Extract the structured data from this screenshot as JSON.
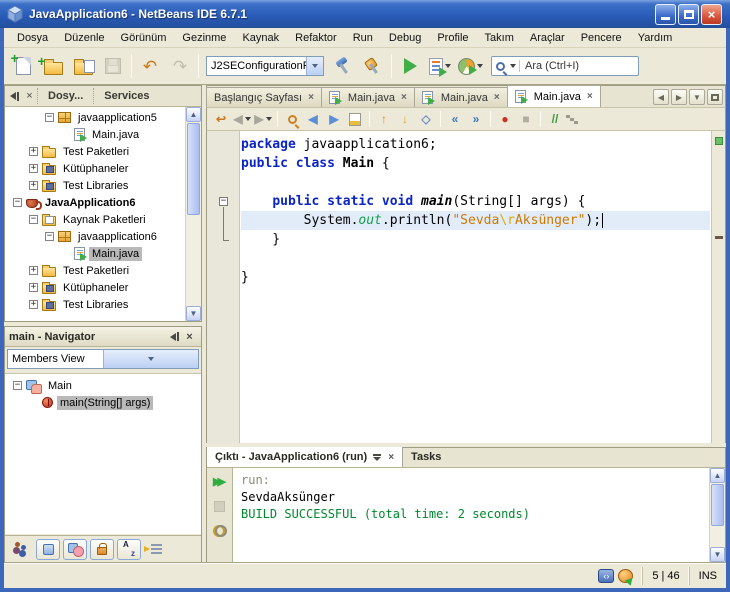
{
  "window": {
    "title": "JavaApplication6 - NetBeans IDE 6.7.1"
  },
  "menu": [
    "Dosya",
    "Düzenle",
    "Görünüm",
    "Gezinme",
    "Kaynak",
    "Refaktor",
    "Run",
    "Debug",
    "Profile",
    "Takım",
    "Araçlar",
    "Pencere",
    "Yardım"
  ],
  "toolbar": {
    "config_value": "J2SEConfigurationPr...",
    "search_placeholder": "Ara (Ctrl+I)",
    "icon_glyphs": {
      "undo": "↶",
      "redo": "↷"
    },
    "buttons": [
      "new-file",
      "new-project",
      "open-project",
      "save-all",
      "undo",
      "redo",
      "build-project",
      "clean-and-build",
      "run-project",
      "debug-project",
      "profile-project",
      "quick-search"
    ]
  },
  "projects": {
    "tabs": [
      "Dosy...",
      "Services"
    ],
    "tree": [
      {
        "indent": 2,
        "expander": "-",
        "icon": "package",
        "label": "javaapplication5"
      },
      {
        "indent": 3,
        "expander": "",
        "icon": "java",
        "label": "Main.java"
      },
      {
        "indent": 1,
        "expander": "+",
        "icon": "folder",
        "label": "Test Paketleri"
      },
      {
        "indent": 1,
        "expander": "+",
        "icon": "folder-lib",
        "label": "Kütüphaneler"
      },
      {
        "indent": 1,
        "expander": "+",
        "icon": "folder-lib",
        "label": "Test Libraries"
      },
      {
        "indent": 0,
        "expander": "-",
        "icon": "project",
        "label": "JavaApplication6",
        "bold": true
      },
      {
        "indent": 1,
        "expander": "-",
        "icon": "folder-src",
        "label": "Kaynak Paketleri"
      },
      {
        "indent": 2,
        "expander": "-",
        "icon": "package",
        "label": "javaapplication6"
      },
      {
        "indent": 3,
        "expander": "",
        "icon": "java",
        "label": "Main.java",
        "selected": true
      },
      {
        "indent": 1,
        "expander": "+",
        "icon": "folder",
        "label": "Test Paketleri"
      },
      {
        "indent": 1,
        "expander": "+",
        "icon": "folder-lib",
        "label": "Kütüphaneler"
      },
      {
        "indent": 1,
        "expander": "+",
        "icon": "folder-lib",
        "label": "Test Libraries"
      }
    ]
  },
  "navigator": {
    "title": "main - Navigator",
    "view": "Members View",
    "tree": [
      {
        "indent": 0,
        "expander": "-",
        "icon": "class",
        "label": "Main"
      },
      {
        "indent": 1,
        "expander": "",
        "icon": "method",
        "label": "main(String[] args)",
        "selected": true
      }
    ],
    "filters": [
      "show-inherited-members",
      "show-fields",
      "show-static-members",
      "show-non-public-members",
      "sort-by-name",
      "sort-by-source"
    ]
  },
  "editor": {
    "tabs": [
      {
        "label": "Başlangıç Sayfası",
        "icon": ""
      },
      {
        "label": "Main.java",
        "icon": "java"
      },
      {
        "label": "Main.java",
        "icon": "java"
      },
      {
        "label": "Main.java",
        "icon": "java",
        "active": true
      }
    ],
    "toolbar": [
      {
        "name": "last-edit-position",
        "glyph": "↩",
        "color": "#c87820"
      },
      {
        "name": "back",
        "glyph": "◀",
        "color": "#aaa89c",
        "dd": true
      },
      {
        "name": "forward",
        "glyph": "▶",
        "color": "#aaa89c",
        "dd": true
      },
      {
        "sep": true
      },
      {
        "name": "find",
        "css": "mag orange"
      },
      {
        "name": "find-previous",
        "glyph": "◀",
        "color": "#5b8ed6"
      },
      {
        "name": "find-next",
        "glyph": "▶",
        "color": "#5b8ed6"
      },
      {
        "name": "toggle-highlight",
        "css": "hl-block"
      },
      {
        "sep": true
      },
      {
        "name": "previous-bookmark",
        "glyph": "↑",
        "color": "#e08830"
      },
      {
        "name": "next-bookmark",
        "glyph": "↓",
        "color": "#d4b020"
      },
      {
        "name": "toggle-bookmark",
        "glyph": "◇",
        "color": "#7090c8"
      },
      {
        "sep": true
      },
      {
        "name": "shift-line-left",
        "glyph": "«",
        "color": "#3a7abf"
      },
      {
        "name": "shift-line-right",
        "glyph": "»",
        "color": "#3a7abf"
      },
      {
        "sep": true
      },
      {
        "name": "start-macro-recording",
        "glyph": "●",
        "color": "#d03020"
      },
      {
        "name": "stop-macro-recording",
        "glyph": "■",
        "color": "#b0ada0"
      },
      {
        "sep": true
      },
      {
        "name": "comment",
        "glyph": "//",
        "color": "#3f9b41"
      },
      {
        "name": "uncomment",
        "css": "steps"
      }
    ],
    "code": [
      {
        "tokens": [
          {
            "t": "package",
            "c": "kw"
          },
          {
            "t": " javaapplication6;",
            "c": ""
          }
        ]
      },
      {
        "tokens": [
          {
            "t": "public class",
            "c": "kw"
          },
          {
            "t": " ",
            "c": ""
          },
          {
            "t": "Main",
            "c": "cls"
          },
          {
            "t": " {",
            "c": ""
          }
        ]
      },
      {
        "tokens": []
      },
      {
        "tokens": [
          {
            "t": "    ",
            "c": ""
          },
          {
            "t": "public static void",
            "c": "kw"
          },
          {
            "t": " ",
            "c": ""
          },
          {
            "t": "main",
            "c": "mth"
          },
          {
            "t": "(String[] args) {",
            "c": ""
          }
        ],
        "fold": "start"
      },
      {
        "tokens": [
          {
            "t": "        System.",
            "c": ""
          },
          {
            "t": "out",
            "c": "fld"
          },
          {
            "t": ".println(",
            "c": ""
          },
          {
            "t": "\"Sevda",
            "c": "str"
          },
          {
            "t": "\\r",
            "c": "esc"
          },
          {
            "t": "Aksünger\"",
            "c": "str"
          },
          {
            "t": ");",
            "c": ""
          }
        ],
        "highlight": true
      },
      {
        "tokens": [
          {
            "t": "    }",
            "c": ""
          }
        ],
        "fold": "end"
      },
      {
        "tokens": []
      },
      {
        "tokens": [
          {
            "t": "}",
            "c": ""
          }
        ]
      }
    ]
  },
  "output": {
    "tabs": [
      {
        "label": "Çıktı - JavaApplication6 (run)",
        "active": true
      },
      {
        "label": "Tasks"
      }
    ],
    "buttons": [
      "rerun",
      "stop",
      "ant-settings"
    ],
    "lines": [
      {
        "text": "run:",
        "c": "run"
      },
      {
        "text": "SevdaAksünger",
        "c": "plain"
      },
      {
        "text": "BUILD SUCCESSFUL (total time: 2 seconds)",
        "c": "success"
      }
    ]
  },
  "statusbar": {
    "caret": "5 | 46",
    "mode": "INS"
  },
  "colors": {
    "titlebar_blue": "#2a5cb8",
    "ui_beige": "#ece9d8",
    "keyword_blue": "#0b24c8",
    "string_orange": "#cd7a00",
    "escape_yellow": "#dfa900",
    "field_green": "#13a04b",
    "success_green": "#00892c",
    "selection_gray": "#b9b9b9",
    "current_line": "#e2ecf8"
  }
}
